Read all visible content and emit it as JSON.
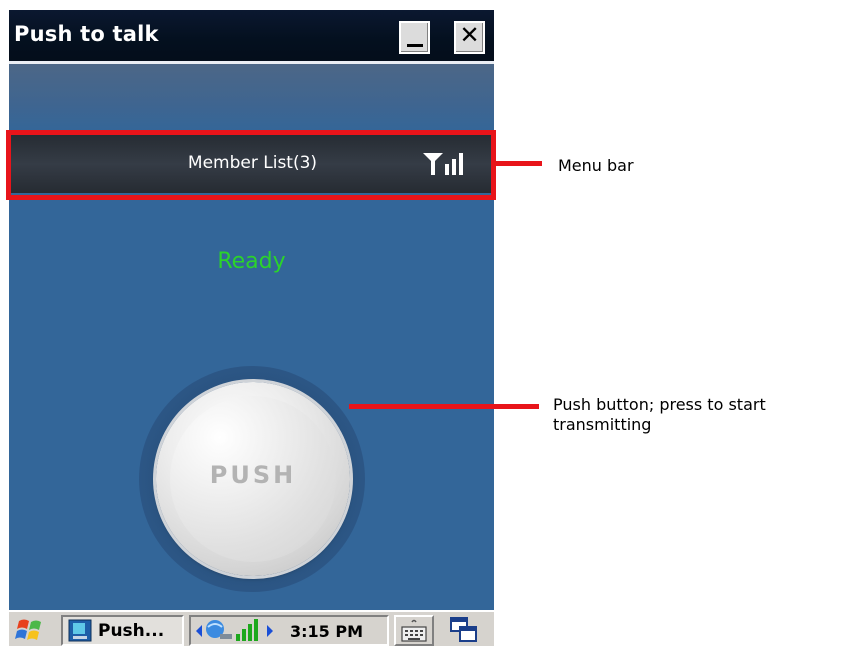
{
  "window": {
    "title": "Push to talk",
    "minimize_label": "_",
    "close_label": "✕"
  },
  "menu_bar": {
    "label": "Member List(3)",
    "signal_icon": "signal-bars-icon"
  },
  "status": {
    "text": "Ready",
    "color": "#2bd32b"
  },
  "push_button": {
    "label": "PUSH"
  },
  "taskbar": {
    "task_label": "Push...",
    "clock": "3:15 PM",
    "icons": [
      "windows-start-icon",
      "app-task-icon",
      "network-icon",
      "signal-icon",
      "keyboard-icon",
      "desktop-icon"
    ]
  },
  "annotations": {
    "menu_bar_caption": "Menu bar",
    "push_caption_line1": "Push button; press to start",
    "push_caption_line2": "transmitting",
    "accent_color": "#e8141a"
  }
}
